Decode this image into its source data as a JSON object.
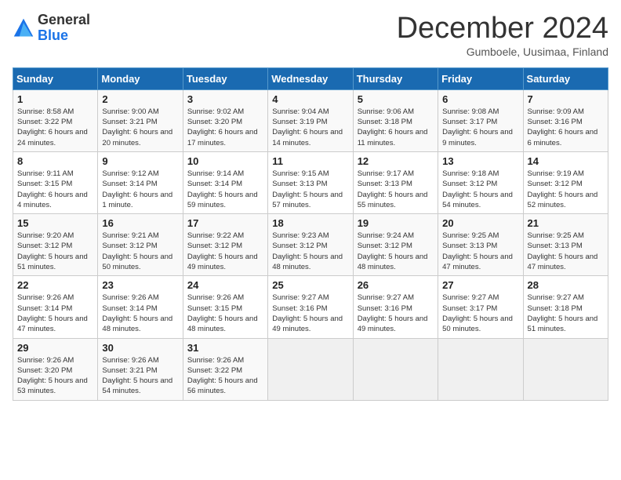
{
  "logo": {
    "general": "General",
    "blue": "Blue"
  },
  "title": "December 2024",
  "subtitle": "Gumboele, Uusimaa, Finland",
  "days_of_week": [
    "Sunday",
    "Monday",
    "Tuesday",
    "Wednesday",
    "Thursday",
    "Friday",
    "Saturday"
  ],
  "weeks": [
    [
      {
        "day": "1",
        "sunrise": "8:58 AM",
        "sunset": "3:22 PM",
        "daylight": "6 hours and 24 minutes."
      },
      {
        "day": "2",
        "sunrise": "9:00 AM",
        "sunset": "3:21 PM",
        "daylight": "6 hours and 20 minutes."
      },
      {
        "day": "3",
        "sunrise": "9:02 AM",
        "sunset": "3:20 PM",
        "daylight": "6 hours and 17 minutes."
      },
      {
        "day": "4",
        "sunrise": "9:04 AM",
        "sunset": "3:19 PM",
        "daylight": "6 hours and 14 minutes."
      },
      {
        "day": "5",
        "sunrise": "9:06 AM",
        "sunset": "3:18 PM",
        "daylight": "6 hours and 11 minutes."
      },
      {
        "day": "6",
        "sunrise": "9:08 AM",
        "sunset": "3:17 PM",
        "daylight": "6 hours and 9 minutes."
      },
      {
        "day": "7",
        "sunrise": "9:09 AM",
        "sunset": "3:16 PM",
        "daylight": "6 hours and 6 minutes."
      }
    ],
    [
      {
        "day": "8",
        "sunrise": "9:11 AM",
        "sunset": "3:15 PM",
        "daylight": "6 hours and 4 minutes."
      },
      {
        "day": "9",
        "sunrise": "9:12 AM",
        "sunset": "3:14 PM",
        "daylight": "6 hours and 1 minute."
      },
      {
        "day": "10",
        "sunrise": "9:14 AM",
        "sunset": "3:14 PM",
        "daylight": "5 hours and 59 minutes."
      },
      {
        "day": "11",
        "sunrise": "9:15 AM",
        "sunset": "3:13 PM",
        "daylight": "5 hours and 57 minutes."
      },
      {
        "day": "12",
        "sunrise": "9:17 AM",
        "sunset": "3:13 PM",
        "daylight": "5 hours and 55 minutes."
      },
      {
        "day": "13",
        "sunrise": "9:18 AM",
        "sunset": "3:12 PM",
        "daylight": "5 hours and 54 minutes."
      },
      {
        "day": "14",
        "sunrise": "9:19 AM",
        "sunset": "3:12 PM",
        "daylight": "5 hours and 52 minutes."
      }
    ],
    [
      {
        "day": "15",
        "sunrise": "9:20 AM",
        "sunset": "3:12 PM",
        "daylight": "5 hours and 51 minutes."
      },
      {
        "day": "16",
        "sunrise": "9:21 AM",
        "sunset": "3:12 PM",
        "daylight": "5 hours and 50 minutes."
      },
      {
        "day": "17",
        "sunrise": "9:22 AM",
        "sunset": "3:12 PM",
        "daylight": "5 hours and 49 minutes."
      },
      {
        "day": "18",
        "sunrise": "9:23 AM",
        "sunset": "3:12 PM",
        "daylight": "5 hours and 48 minutes."
      },
      {
        "day": "19",
        "sunrise": "9:24 AM",
        "sunset": "3:12 PM",
        "daylight": "5 hours and 48 minutes."
      },
      {
        "day": "20",
        "sunrise": "9:25 AM",
        "sunset": "3:13 PM",
        "daylight": "5 hours and 47 minutes."
      },
      {
        "day": "21",
        "sunrise": "9:25 AM",
        "sunset": "3:13 PM",
        "daylight": "5 hours and 47 minutes."
      }
    ],
    [
      {
        "day": "22",
        "sunrise": "9:26 AM",
        "sunset": "3:14 PM",
        "daylight": "5 hours and 47 minutes."
      },
      {
        "day": "23",
        "sunrise": "9:26 AM",
        "sunset": "3:14 PM",
        "daylight": "5 hours and 48 minutes."
      },
      {
        "day": "24",
        "sunrise": "9:26 AM",
        "sunset": "3:15 PM",
        "daylight": "5 hours and 48 minutes."
      },
      {
        "day": "25",
        "sunrise": "9:27 AM",
        "sunset": "3:16 PM",
        "daylight": "5 hours and 49 minutes."
      },
      {
        "day": "26",
        "sunrise": "9:27 AM",
        "sunset": "3:16 PM",
        "daylight": "5 hours and 49 minutes."
      },
      {
        "day": "27",
        "sunrise": "9:27 AM",
        "sunset": "3:17 PM",
        "daylight": "5 hours and 50 minutes."
      },
      {
        "day": "28",
        "sunrise": "9:27 AM",
        "sunset": "3:18 PM",
        "daylight": "5 hours and 51 minutes."
      }
    ],
    [
      {
        "day": "29",
        "sunrise": "9:26 AM",
        "sunset": "3:20 PM",
        "daylight": "5 hours and 53 minutes."
      },
      {
        "day": "30",
        "sunrise": "9:26 AM",
        "sunset": "3:21 PM",
        "daylight": "5 hours and 54 minutes."
      },
      {
        "day": "31",
        "sunrise": "9:26 AM",
        "sunset": "3:22 PM",
        "daylight": "5 hours and 56 minutes."
      },
      null,
      null,
      null,
      null
    ]
  ],
  "labels": {
    "sunrise": "Sunrise:",
    "sunset": "Sunset:",
    "daylight": "Daylight:"
  }
}
